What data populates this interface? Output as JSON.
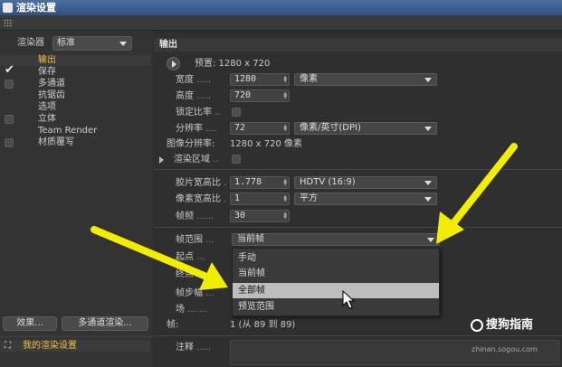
{
  "window": {
    "title": "渲染设置"
  },
  "left": {
    "renderer_label": "渲染器",
    "renderer_value": "标准",
    "items": [
      {
        "label": "输出",
        "checked": false,
        "active": true
      },
      {
        "label": "保存",
        "checked": true
      },
      {
        "label": "多通道",
        "checked": false
      },
      {
        "label": "抗锯齿"
      },
      {
        "label": "选项"
      },
      {
        "label": "立体",
        "checked": false
      },
      {
        "label": "Team Render"
      },
      {
        "label": "材质覆写",
        "checked": false
      }
    ],
    "effects_button": "效果...",
    "multipass_button": "多通道渲染...",
    "my_settings": "我的渲染设置"
  },
  "main": {
    "section_title": "输出",
    "preset_label": "预置: 1280 x 720",
    "width_label": "宽度",
    "width_value": "1280",
    "unit_value": "像素",
    "height_label": "高度",
    "height_value": "720",
    "lock_ratio_label": "锁定比率",
    "resolution_label": "分辨率",
    "resolution_value": "72",
    "resolution_unit": "像素/英寸(DPI)",
    "image_resolution_label": "图像分辨率:",
    "image_resolution_value": "1280 x 720 像素",
    "render_region_label": "渲染区域",
    "film_aspect_label": "胶片宽高比",
    "film_aspect_value": "1.778",
    "film_aspect_preset": "HDTV (16:9)",
    "pixel_aspect_label": "像素宽高比",
    "pixel_aspect_value": "1",
    "pixel_aspect_preset": "平方",
    "frame_rate_label": "帧频",
    "frame_rate_value": "30",
    "frame_range_label": "帧范围",
    "frame_range_value": "当前帧",
    "start_label": "起点",
    "end_label": "终点",
    "frame_step_label": "帧步幅",
    "fields_label": "场",
    "frames_label": "帧:",
    "frames_value": "1 (从 89 到 89)",
    "notes_label": "注释"
  },
  "dropdown": {
    "options": [
      "手动",
      "当前帧",
      "全部帧",
      "预览范围"
    ],
    "highlighted": "全部帧"
  },
  "watermark": {
    "brand": "搜狗指南",
    "url": "zhinan.sogou.com"
  },
  "colors": {
    "arrow": "#f2ee00",
    "title_bar": "#3d5f90",
    "accent": "#f0c040"
  }
}
